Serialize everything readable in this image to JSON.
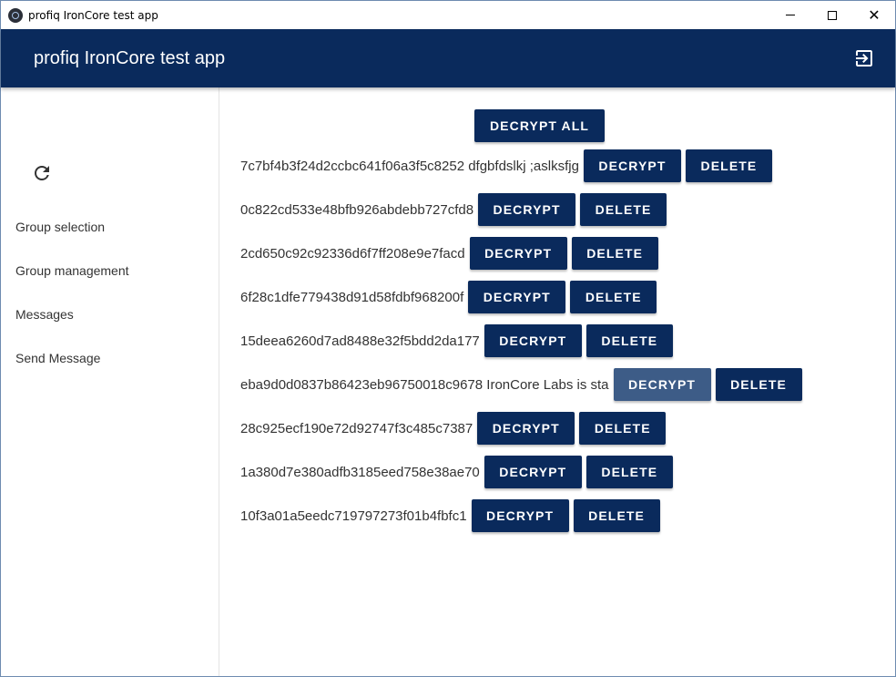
{
  "window": {
    "title": "profiq IronCore test app",
    "controls": {
      "minimize": "minimize",
      "maximize": "maximize",
      "close": "✕"
    }
  },
  "header": {
    "title": "profiq IronCore test app",
    "logout_icon": "logout-icon"
  },
  "sidebar": {
    "refresh_icon": "refresh-icon",
    "items": [
      {
        "label": "Group selection"
      },
      {
        "label": "Group management"
      },
      {
        "label": "Messages"
      },
      {
        "label": "Send Message"
      }
    ]
  },
  "main": {
    "decrypt_all_label": "DECRYPT ALL",
    "decrypt_label": "DECRYPT",
    "delete_label": "DELETE",
    "messages": [
      {
        "text": "7c7bf4b3f24d2ccbc641f06a3f5c8252 dfgbfdslkj ;aslksfjg"
      },
      {
        "text": "0c822cd533e48bfb926abdebb727cfd8"
      },
      {
        "text": "2cd650c92c92336d6f7ff208e9e7facd"
      },
      {
        "text": "6f28c1dfe779438d91d58fdbf968200f"
      },
      {
        "text": "15deea6260d7ad8488e32f5bdd2da177"
      },
      {
        "text": "eba9d0d0837b86423eb96750018c9678 IronCore Labs is sta"
      },
      {
        "text": "28c925ecf190e72d92747f3c485c7387"
      },
      {
        "text": "1a380d7e380adfb3185eed758e38ae70"
      },
      {
        "text": "10f3a01a5eedc719797273f01b4fbfc1"
      }
    ]
  },
  "colors": {
    "primary": "#0a2a5c",
    "button_hover": "#3d5c87"
  }
}
